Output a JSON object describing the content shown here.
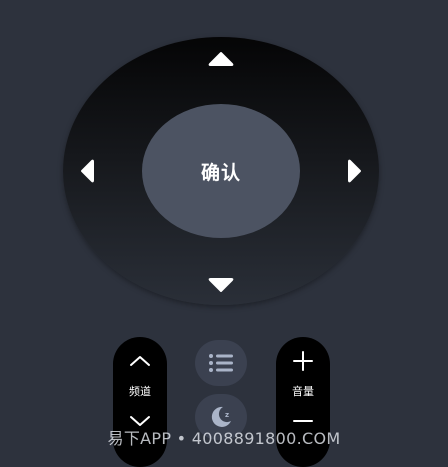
{
  "dpad": {
    "ok_label": "确认",
    "icons": {
      "up": "triangle-up-icon",
      "down": "triangle-down-icon",
      "left": "triangle-left-icon",
      "right": "triangle-right-icon"
    }
  },
  "channel": {
    "label": "频道",
    "up_icon": "chevron-up-icon",
    "down_icon": "chevron-down-icon"
  },
  "volume": {
    "label": "音量",
    "up_icon": "plus-icon",
    "down_icon": "minus-icon"
  },
  "center_buttons": {
    "menu_icon": "list-menu-icon",
    "sleep_icon": "moon-sleep-icon"
  },
  "watermark": {
    "text": "易下APP • 4008891800.COM"
  },
  "colors": {
    "background": "#2d323d",
    "ok_button": "#4c5362",
    "center_button": "#3b4150",
    "pill": "#000000",
    "icon": "#ffffff",
    "icon_muted": "#aab4c8"
  }
}
